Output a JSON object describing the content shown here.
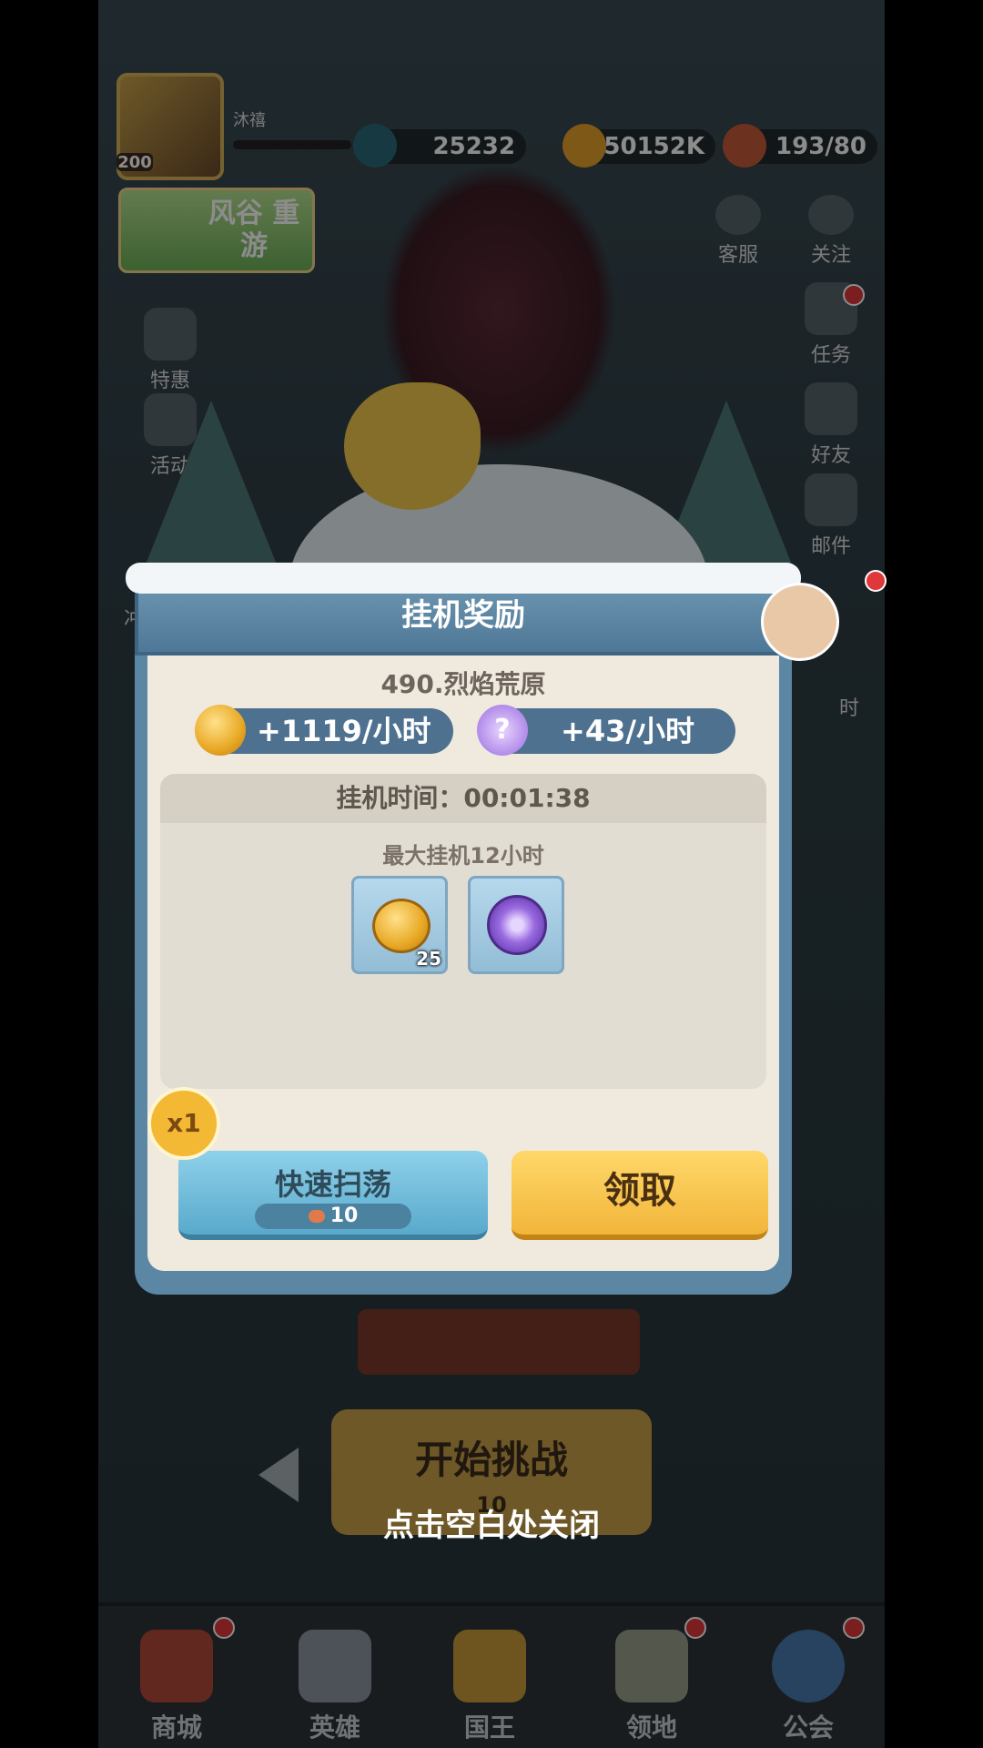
{
  "top": {
    "level": "200",
    "player_name": "沐禧",
    "diamonds": "25232",
    "gold": "50152K",
    "stamina": "193/80"
  },
  "side_left": {
    "banner": "风谷 重游",
    "items": [
      "特惠",
      "活动",
      "冲"
    ]
  },
  "side_right": {
    "items": [
      "客服",
      "关注",
      "任务",
      "好友",
      "邮件",
      "时"
    ]
  },
  "dialog": {
    "title": "挂机奖励",
    "stage": "490.烈焰荒原",
    "gold_rate": "+1119/小时",
    "exp_rate": "+43/小时",
    "idle_time": "挂机时间：00:01:38",
    "max_idle": "最大挂机12小时",
    "rewards": [
      {
        "icon": "gold-coin-icon",
        "qty": "25"
      },
      {
        "icon": "purple-emblem-icon",
        "qty": ""
      }
    ],
    "multiplier": "x1",
    "sweep_label": "快速扫荡",
    "sweep_cost": "10",
    "claim_label": "领取"
  },
  "background": {
    "start_label": "开始挑战",
    "start_cost": "10",
    "close_hint": "点击空白处关闭"
  },
  "navbar": [
    "商城",
    "英雄",
    "国王",
    "领地",
    "公会"
  ]
}
